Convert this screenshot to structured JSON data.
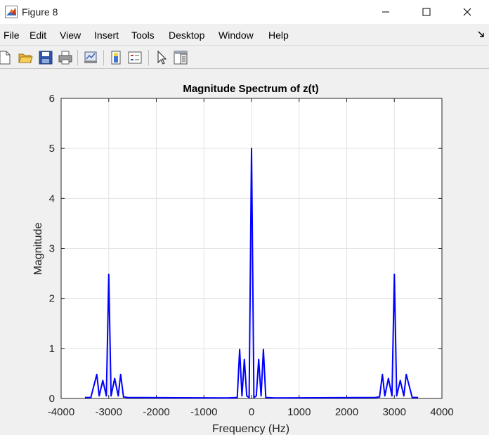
{
  "window": {
    "title": "Figure 8"
  },
  "menu": {
    "items": [
      "File",
      "Edit",
      "View",
      "Insert",
      "Tools",
      "Desktop",
      "Window",
      "Help"
    ]
  },
  "toolbar": {
    "icons": [
      "new-figure-icon",
      "open-file-icon",
      "save-icon",
      "print-icon",
      "link-plot-icon",
      "insert-colorbar-icon",
      "insert-legend-icon",
      "edit-plot-icon",
      "property-inspector-icon"
    ]
  },
  "colors": {
    "line": "#0000ff",
    "axes_bg": "#ffffff",
    "figure_bg": "#f0f0f0",
    "grid": "#e3e3e3"
  },
  "chart_data": {
    "type": "line",
    "title": "Magnitude Spectrum of z(t)",
    "xlabel": "Frequency (Hz)",
    "ylabel": "Magnitude",
    "xlim": [
      -4000,
      4000
    ],
    "ylim": [
      0,
      6
    ],
    "xticks": [
      -4000,
      -3000,
      -2000,
      -1000,
      0,
      1000,
      2000,
      3000,
      4000
    ],
    "yticks": [
      0,
      1,
      2,
      3,
      4,
      5,
      6
    ],
    "grid": true,
    "x": [
      -3500,
      -3375,
      -3250,
      -3200,
      -3125,
      -3050,
      -3000,
      -2950,
      -2875,
      -2800,
      -2750,
      -2690,
      -2600,
      -500,
      -300,
      -250,
      -200,
      -150,
      -100,
      -50,
      0,
      50,
      100,
      150,
      200,
      250,
      300,
      500,
      2600,
      2690,
      2750,
      2800,
      2875,
      2950,
      3000,
      3050,
      3125,
      3200,
      3250,
      3375,
      3500
    ],
    "y": [
      0.02,
      0.02,
      0.48,
      0.05,
      0.36,
      0.05,
      2.48,
      0.05,
      0.4,
      0.05,
      0.48,
      0.03,
      0.02,
      0.01,
      0.02,
      0.98,
      0.05,
      0.78,
      0.05,
      0.02,
      5.0,
      0.02,
      0.05,
      0.78,
      0.05,
      0.98,
      0.02,
      0.01,
      0.02,
      0.03,
      0.48,
      0.05,
      0.4,
      0.05,
      2.48,
      0.05,
      0.36,
      0.05,
      0.48,
      0.02,
      0.02
    ]
  }
}
